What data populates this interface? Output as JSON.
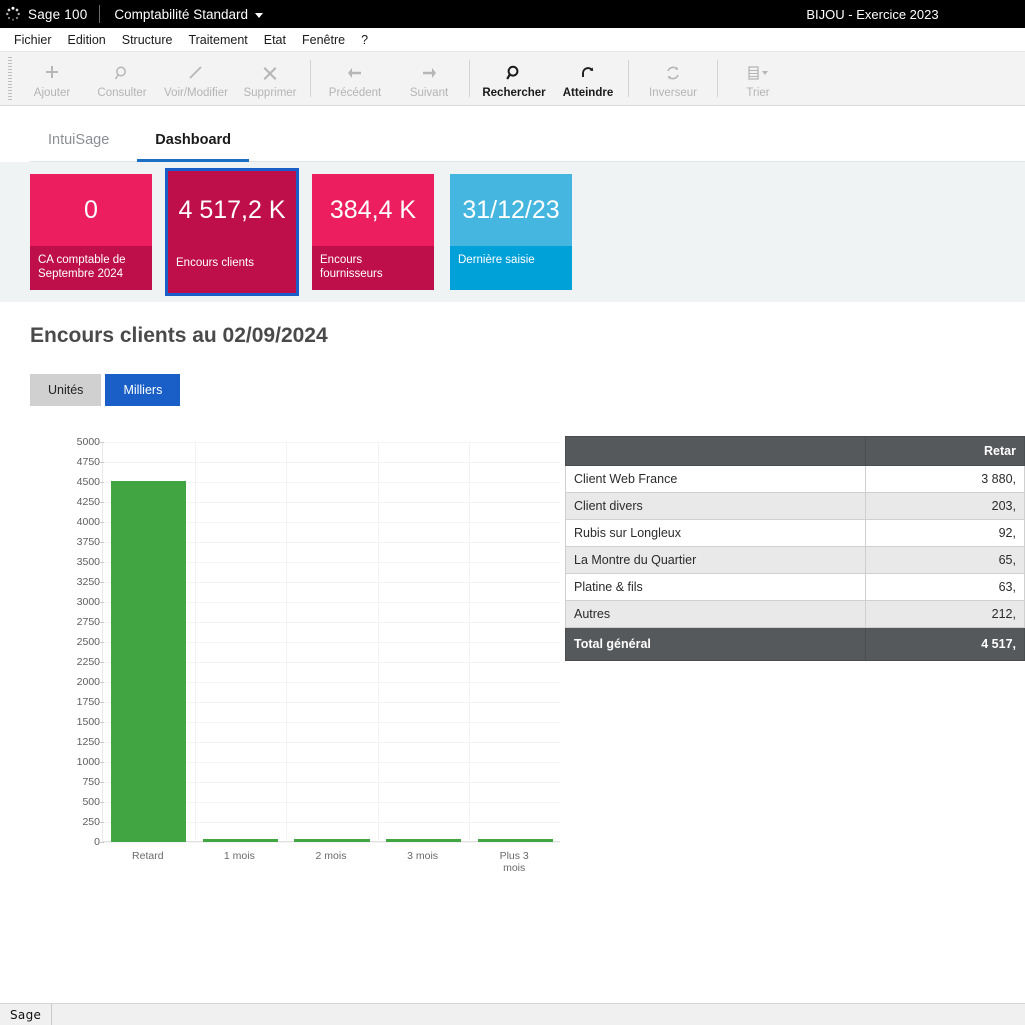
{
  "titlebar": {
    "app_name": "Sage 100",
    "module": "Comptabilité Standard",
    "company": "BIJOU - Exercice 2023",
    "logo_icon": "sage-spinner-icon",
    "caret_icon": "chevron-down-icon"
  },
  "menubar": {
    "items": [
      {
        "label": "Fichier"
      },
      {
        "label": "Edition"
      },
      {
        "label": "Structure"
      },
      {
        "label": "Traitement"
      },
      {
        "label": "Etat"
      },
      {
        "label": "Fenêtre"
      },
      {
        "label": "?"
      }
    ]
  },
  "toolbar": {
    "buttons": [
      {
        "label": "Ajouter",
        "icon": "plus-icon",
        "enabled": false
      },
      {
        "label": "Consulter",
        "icon": "magnifier-icon",
        "enabled": false
      },
      {
        "label": "Voir/Modifier",
        "icon": "pencil-icon",
        "enabled": false
      },
      {
        "label": "Supprimer",
        "icon": "close-x-icon",
        "enabled": false
      },
      {
        "label": "Précédent",
        "icon": "arrow-left-icon",
        "enabled": false
      },
      {
        "label": "Suivant",
        "icon": "arrow-right-icon",
        "enabled": false
      },
      {
        "label": "Rechercher",
        "icon": "search-icon",
        "enabled": true
      },
      {
        "label": "Atteindre",
        "icon": "goto-arc-icon",
        "enabled": true
      },
      {
        "label": "Inverseur",
        "icon": "refresh-cycle-icon",
        "enabled": false
      },
      {
        "label": "Trier",
        "icon": "sort-list-icon",
        "enabled": false
      }
    ]
  },
  "tabs": [
    {
      "label": "IntuiSage",
      "active": false
    },
    {
      "label": "Dashboard",
      "active": true
    }
  ],
  "kpis": [
    {
      "value": "0",
      "caption": "CA comptable de Septembre 2024",
      "color": "#ed1e5f",
      "selected": false
    },
    {
      "value": "4 517,2 K",
      "caption": "Encours clients",
      "color": "#bf0f4b",
      "selected": true
    },
    {
      "value": "384,4 K",
      "caption": "Encours fournisseurs",
      "color": "#ed1e5f",
      "selected": false
    },
    {
      "value": "31/12/23",
      "caption": "Dernière saisie",
      "color": "#45b6e0",
      "selected": false
    }
  ],
  "section": {
    "title": "Encours clients au 02/09/2024",
    "unit_toggles": [
      {
        "label": "Unités",
        "active": false
      },
      {
        "label": "Milliers",
        "active": true
      }
    ]
  },
  "chart_data": {
    "type": "bar",
    "title": "Encours clients au 02/09/2024",
    "xlabel": "",
    "ylabel": "",
    "unit": "Milliers",
    "categories": [
      "Retard",
      "1 mois",
      "2 mois",
      "3 mois",
      "Plus 3 mois"
    ],
    "values": [
      4517.2,
      0,
      0,
      0,
      0
    ],
    "series": [
      {
        "name": "Encours clients",
        "color": "#41a541",
        "values": [
          4517.2,
          0,
          0,
          0,
          0
        ]
      }
    ],
    "ylim": [
      0,
      5000
    ],
    "ytick_step": 250,
    "yticks": [
      5000,
      4750,
      4500,
      4250,
      4000,
      3750,
      3500,
      3250,
      3000,
      2750,
      2500,
      2250,
      2000,
      1750,
      1500,
      1250,
      1000,
      750,
      500,
      250,
      0
    ],
    "grid": true,
    "legend": false
  },
  "table": {
    "columns": [
      {
        "key": "client",
        "label": ""
      },
      {
        "key": "retard",
        "label": "Retar"
      }
    ],
    "rows": [
      {
        "client": "Client Web France",
        "retard": "3 880,"
      },
      {
        "client": "Client divers",
        "retard": "203,"
      },
      {
        "client": "Rubis sur Longleux",
        "retard": "92,"
      },
      {
        "client": "La Montre du Quartier",
        "retard": "65,"
      },
      {
        "client": "Platine & fils",
        "retard": "63,"
      },
      {
        "client": "Autres",
        "retard": "212,"
      }
    ],
    "total": {
      "client": "Total général",
      "retard": "4 517,"
    }
  },
  "statusbar": {
    "brand": "Sage"
  }
}
